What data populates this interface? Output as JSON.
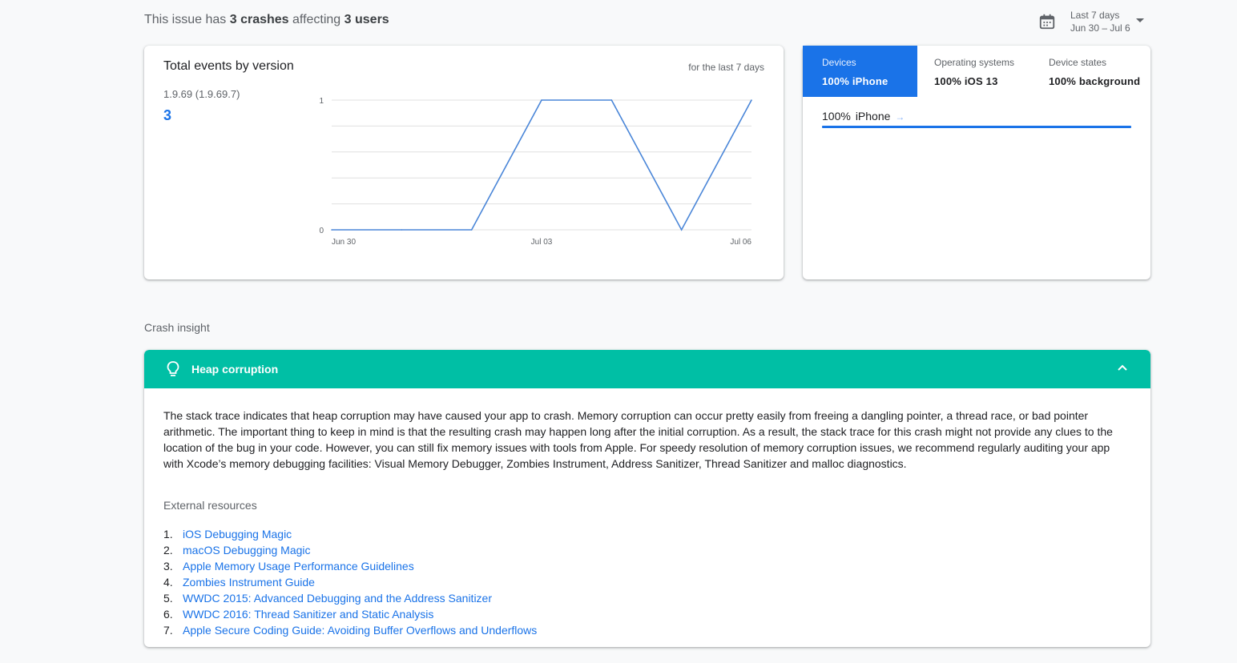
{
  "summary": {
    "prefix": "This issue has ",
    "crashes": "3 crashes",
    "mid": " affecting ",
    "users": "3 users"
  },
  "date_range": {
    "label": "Last 7 days",
    "range": "Jun 30 – Jul 6",
    "icon": "calendar-icon"
  },
  "chart_card": {
    "title": "Total events by version",
    "subtitle": "for the last 7 days",
    "version_label": "1.9.69 (1.9.69.7)",
    "version_count": "3"
  },
  "chart_data": {
    "type": "line",
    "x": [
      "Jun 30",
      "Jul 01",
      "Jul 02",
      "Jul 03",
      "Jul 04",
      "Jul 05",
      "Jul 06"
    ],
    "x_tick_labels": [
      "Jun 30",
      "Jul 03",
      "Jul 06"
    ],
    "series": [
      {
        "values": [
          0,
          0,
          0,
          1,
          1,
          0,
          1
        ]
      }
    ],
    "ylim": [
      0,
      1
    ],
    "y_tick_labels": [
      "0",
      "1"
    ],
    "grid": true,
    "color": "#4a86d8"
  },
  "breakdown": {
    "tabs": [
      {
        "name": "Devices",
        "value": "100% iPhone",
        "active": true
      },
      {
        "name": "Operating systems",
        "value": "100% iOS 13",
        "active": false
      },
      {
        "name": "Device states",
        "value": "100% background",
        "active": false
      }
    ],
    "row": {
      "pct": "100%",
      "label": "iPhone",
      "fraction": 1.0
    }
  },
  "insight": {
    "section_label": "Crash insight",
    "title": "Heap corruption",
    "body": "The stack trace indicates that heap corruption may have caused your app to crash. Memory corruption can occur pretty easily from freeing a dangling pointer, a thread race, or bad pointer arithmetic. The important thing to keep in mind is that the resulting crash may happen long after the initial corruption. As a result, the stack trace for this crash might not provide any clues to the location of the bug in your code. However, you can still fix memory issues with tools from Apple. For speedy resolution of memory corruption issues, we recommend regularly auditing your app with Xcode’s memory debugging facilities: Visual Memory Debugger, Zombies Instrument, Address Sanitizer, Thread Sanitizer and malloc diagnostics.",
    "resources_label": "External resources",
    "resources": [
      {
        "num": "1.",
        "text": "iOS Debugging Magic"
      },
      {
        "num": "2.",
        "text": "macOS Debugging Magic"
      },
      {
        "num": "3.",
        "text": "Apple Memory Usage Performance Guidelines"
      },
      {
        "num": "4.",
        "text": "Zombies Instrument Guide"
      },
      {
        "num": "5.",
        "text": "WWDC 2015: Advanced Debugging and the Address Sanitizer"
      },
      {
        "num": "6.",
        "text": "WWDC 2016: Thread Sanitizer and Static Analysis"
      },
      {
        "num": "7.",
        "text": "Apple Secure Coding Guide: Avoiding Buffer Overflows and Underflows"
      }
    ]
  }
}
